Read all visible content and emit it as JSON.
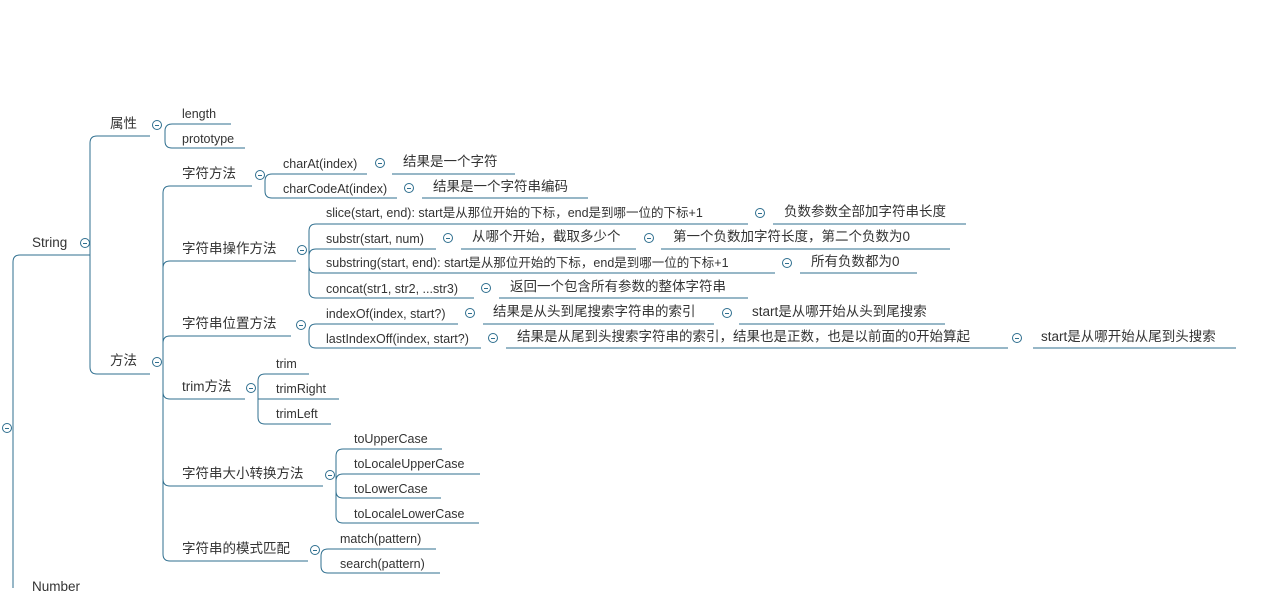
{
  "mindmap": {
    "root_toggle": "collapse-icon",
    "string": {
      "label": "String",
      "attributes": {
        "label": "属性",
        "items": [
          "length",
          "prototype"
        ]
      },
      "methods": {
        "label": "方法",
        "char_methods": {
          "label": "字符方法",
          "charAt": {
            "label": "charAt(index)",
            "note": "结果是一个字符"
          },
          "charCodeAt": {
            "label": "charCodeAt(index)",
            "note": "结果是一个字符串编码"
          }
        },
        "string_ops": {
          "label": "字符串操作方法",
          "slice": {
            "label": "slice(start, end): start是从那位开始的下标，end是到哪一位的下标+1",
            "note": "负数参数全部加字符串长度"
          },
          "substr": {
            "label": "substr(start, num)",
            "note1": "从哪个开始，截取多少个",
            "note2": "第一个负数加字符长度，第二个负数为0"
          },
          "substring": {
            "label": "substring(start, end): start是从那位开始的下标，end是到哪一位的下标+1",
            "note": "所有负数都为0"
          },
          "concat": {
            "label": "concat(str1, str2, ...str3)",
            "note": "返回一个包含所有参数的整体字符串"
          }
        },
        "position_methods": {
          "label": "字符串位置方法",
          "indexOf": {
            "label": "indexOf(index, start?)",
            "note1": "结果是从头到尾搜索字符串的索引",
            "note2": "start是从哪开始从头到尾搜索"
          },
          "lastIndexOf": {
            "label": "lastIndexOff(index, start?)",
            "note1": "结果是从尾到头搜索字符串的索引，结果也是正数，也是以前面的0开始算起",
            "note2": "start是从哪开始从尾到头搜索"
          }
        },
        "trim_methods": {
          "label": "trim方法",
          "items": [
            "trim",
            "trimRight",
            "trimLeft"
          ]
        },
        "case_methods": {
          "label": "字符串大小转换方法",
          "items": [
            "toUpperCase",
            "toLocaleUpperCase",
            "toLowerCase",
            "toLocaleLowerCase"
          ]
        },
        "pattern_methods": {
          "label": "字符串的模式匹配",
          "items": [
            "match(pattern)",
            "search(pattern)"
          ]
        }
      }
    },
    "number": {
      "label": "Number"
    }
  }
}
